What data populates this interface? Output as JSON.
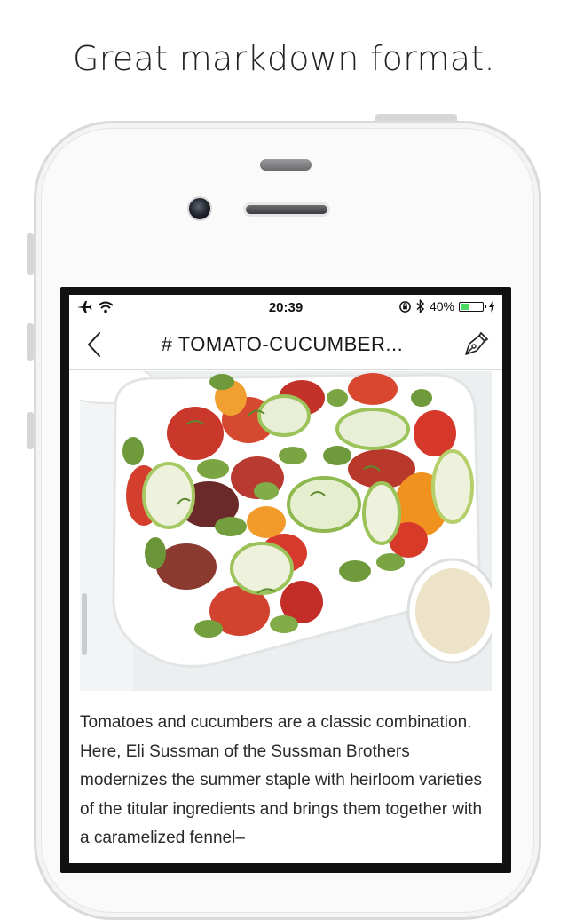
{
  "headline": "Great markdown format.",
  "status_bar": {
    "time": "20:39",
    "battery_percent_label": "40%",
    "battery_level": 0.4,
    "icons": [
      "airplane-icon",
      "wifi-icon",
      "rotation-lock-icon",
      "bluetooth-icon",
      "battery-icon",
      "charging-icon"
    ]
  },
  "nav": {
    "title": "# TOMATO-CUCUMBER...",
    "back_icon": "chevron-left-icon",
    "edit_icon": "pen-nib-icon"
  },
  "article": {
    "image_subject": "tomato-cucumber salad",
    "paragraph": "Tomatoes and cucumbers are a classic combination. Here, Eli Sussman of the Sussman Brothers modernizes the summer staple with heirloom varieties of the titular ingredients and brings them together with a caramelized fennel–"
  },
  "colors": {
    "battery_fill": "#4cd964",
    "phone_body": "#fafafa"
  }
}
